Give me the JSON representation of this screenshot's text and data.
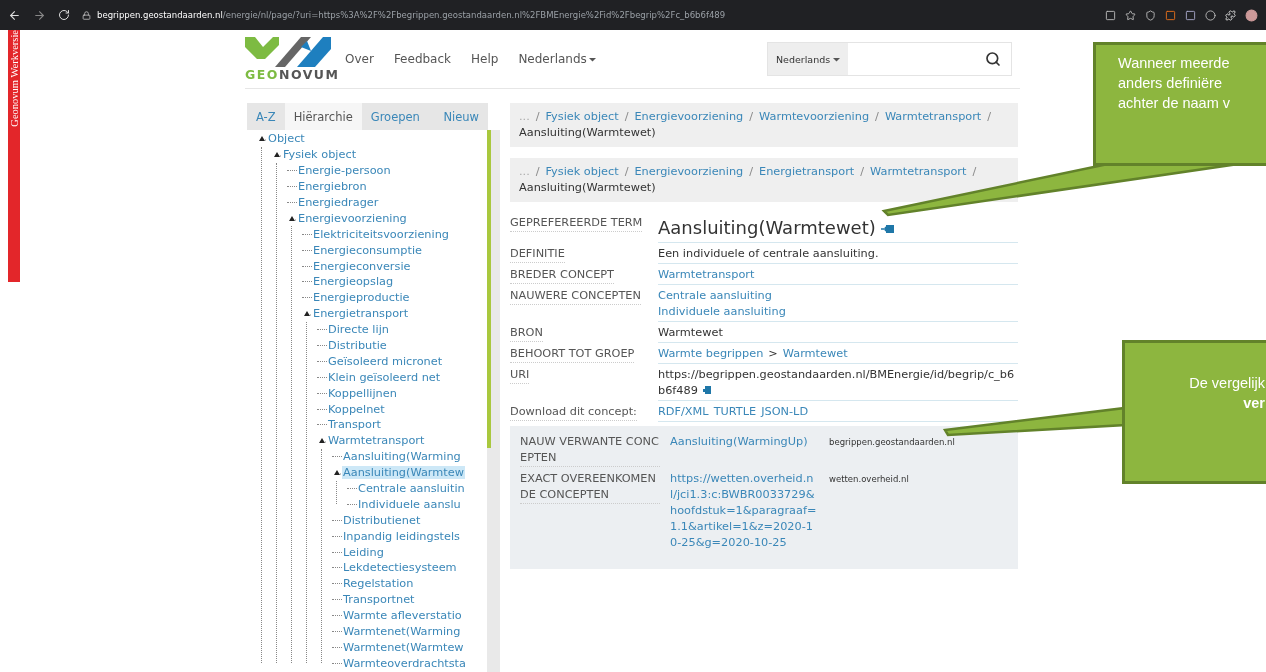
{
  "browser": {
    "host": "begrippen.geostandaarden.nl",
    "path": "/energie/nl/page/?uri=https%3A%2F%2Fbegrippen.geostandaarden.nl%2FBMEnergie%2Fid%2Fbegrip%2Fc_b6b6f489"
  },
  "side_banner": "Geonovum Werkversie",
  "logo_text": [
    "GEO",
    "NOVUM"
  ],
  "nav": [
    {
      "label": "Over",
      "kind": "link"
    },
    {
      "label": "Feedback",
      "kind": "link"
    },
    {
      "label": "Help",
      "kind": "link"
    },
    {
      "label": "Nederlands",
      "kind": "dropdown"
    }
  ],
  "search": {
    "language": "Nederlands"
  },
  "tabs": [
    {
      "label": "A-Z",
      "selected": false
    },
    {
      "label": "Hiërarchie",
      "selected": true
    },
    {
      "label": "Groepen",
      "selected": false
    },
    {
      "label": "Nieuw",
      "selected": false
    }
  ],
  "tree": [
    {
      "label": "Object",
      "expanded": true,
      "selected": false,
      "children": [
        {
          "label": "Fysiek object",
          "expanded": true,
          "selected": false,
          "children": [
            {
              "label": "Energie-persoon",
              "expanded": false,
              "selected": false
            },
            {
              "label": "Energiebron",
              "expanded": false,
              "selected": false
            },
            {
              "label": "Energiedrager",
              "expanded": false,
              "selected": false
            },
            {
              "label": "Energievoorziening",
              "expanded": true,
              "selected": false,
              "children": [
                {
                  "label": "Elektriciteitsvoorziening",
                  "expanded": false,
                  "selected": false
                },
                {
                  "label": "Energieconsumptie",
                  "expanded": false,
                  "selected": false
                },
                {
                  "label": "Energieconversie",
                  "expanded": false,
                  "selected": false
                },
                {
                  "label": "Energieopslag",
                  "expanded": false,
                  "selected": false
                },
                {
                  "label": "Energieproductie",
                  "expanded": false,
                  "selected": false
                },
                {
                  "label": "Energietransport",
                  "expanded": true,
                  "selected": false,
                  "children": [
                    {
                      "label": "Directe lijn",
                      "expanded": false,
                      "selected": false
                    },
                    {
                      "label": "Distributie",
                      "expanded": false,
                      "selected": false
                    },
                    {
                      "label": "Geïsoleerd micronet",
                      "expanded": false,
                      "selected": false
                    },
                    {
                      "label": "Klein geïsoleerd net",
                      "expanded": false,
                      "selected": false
                    },
                    {
                      "label": "Koppellijnen",
                      "expanded": false,
                      "selected": false
                    },
                    {
                      "label": "Koppelnet",
                      "expanded": false,
                      "selected": false
                    },
                    {
                      "label": "Transport",
                      "expanded": false,
                      "selected": false
                    },
                    {
                      "label": "Warmtetransport",
                      "expanded": true,
                      "selected": false,
                      "children": [
                        {
                          "label": "Aansluiting(Warming",
                          "expanded": false,
                          "selected": false
                        },
                        {
                          "label": "Aansluiting(Warmtew",
                          "expanded": true,
                          "selected": true,
                          "children": [
                            {
                              "label": "Centrale aansluitin",
                              "expanded": false,
                              "selected": false
                            },
                            {
                              "label": "Individuele aanslu",
                              "expanded": false,
                              "selected": false
                            }
                          ]
                        },
                        {
                          "label": "Distributienet",
                          "expanded": false,
                          "selected": false
                        },
                        {
                          "label": "Inpandig leidingstels",
                          "expanded": false,
                          "selected": false
                        },
                        {
                          "label": "Leiding",
                          "expanded": false,
                          "selected": false
                        },
                        {
                          "label": "Lekdetectiesysteem",
                          "expanded": false,
                          "selected": false
                        },
                        {
                          "label": "Regelstation",
                          "expanded": false,
                          "selected": false
                        },
                        {
                          "label": "Transportnet",
                          "expanded": false,
                          "selected": false
                        },
                        {
                          "label": "Warmte afleverstatio",
                          "expanded": false,
                          "selected": false
                        },
                        {
                          "label": "Warmtenet(Warming",
                          "expanded": false,
                          "selected": false
                        },
                        {
                          "label": "Warmtenet(Warmtew",
                          "expanded": false,
                          "selected": false
                        },
                        {
                          "label": "Warmteoverdrachtsta",
                          "expanded": false,
                          "selected": false
                        }
                      ]
                    }
                  ]
                }
              ]
            }
          ]
        }
      ]
    }
  ],
  "breadcrumbs": [
    {
      "separator": "/",
      "items": [
        {
          "label": "...",
          "kind": "ellipsis"
        },
        {
          "label": "Fysiek object",
          "kind": "link"
        },
        {
          "label": "Energievoorziening",
          "kind": "link"
        },
        {
          "label": "Warmtevoorziening",
          "kind": "link"
        },
        {
          "label": "Warmtetransport",
          "kind": "link"
        },
        {
          "label": "Aansluiting(Warmtewet)",
          "kind": "current"
        }
      ]
    },
    {
      "separator": "/",
      "items": [
        {
          "label": "...",
          "kind": "ellipsis"
        },
        {
          "label": "Fysiek object",
          "kind": "link"
        },
        {
          "label": "Energievoorziening",
          "kind": "link"
        },
        {
          "label": "Energietransport",
          "kind": "link"
        },
        {
          "label": "Warmtetransport",
          "kind": "link"
        },
        {
          "label": "Aansluiting(Warmtewet)",
          "kind": "current"
        }
      ]
    }
  ],
  "details": [
    {
      "label": "GEPREFEREERDE TERM",
      "kind": "title",
      "values": [
        "Aansluiting(Warmtewet)"
      ]
    },
    {
      "label": "DEFINITIE",
      "kind": "text",
      "values": [
        "Een individuele of centrale aansluiting."
      ]
    },
    {
      "label": "BREDER CONCEPT",
      "kind": "links",
      "values": [
        "Warmtetransport"
      ]
    },
    {
      "label": "NAUWERE CONCEPTEN",
      "kind": "links",
      "values": [
        "Centrale aansluiting",
        "Individuele aansluiting"
      ]
    },
    {
      "label": "BRON",
      "kind": "text",
      "values": [
        "Warmtewet"
      ]
    },
    {
      "label": "BEHOORT TOT GROEP",
      "kind": "path",
      "separator": ">",
      "values": [
        "Warmte begrippen",
        "Warmtewet"
      ]
    },
    {
      "label": "URI",
      "kind": "uri",
      "values": [
        "https://begrippen.geostandaarden.nl/BMEnergie/id/begrip/c_b6b6f489"
      ]
    },
    {
      "label": "Download dit concept:",
      "kind": "inline",
      "values": [
        "RDF/XML",
        "TURTLE",
        "JSON-LD"
      ]
    }
  ],
  "related": [
    {
      "label": "NAUW VERWANTE CONCEPTEN",
      "link": "Aansluiting(WarmingUp)",
      "source": "begrippen.geostandaarden.nl"
    },
    {
      "label": "EXACT OVEREENKOMENDE CONCEPTEN",
      "link": "https://wetten.overheid.nl/jci1.3:c:BWBR0033729&hoofdstuk=1&paragraaf=1.1&artikel=1&z=2020-10-25&g=2020-10-25",
      "source": "wetten.overheid.nl"
    }
  ],
  "callouts": [
    {
      "lines": [
        {
          "text": "Wanneer meerde",
          "bold": false
        },
        {
          "text": "anders definiëre",
          "bold": false
        },
        {
          "text": "achter de naam v",
          "bold": false
        }
      ]
    },
    {
      "lines": [
        {
          "text": "De vergelijk",
          "bold": false
        },
        {
          "text": "ver",
          "bold": true
        }
      ]
    }
  ]
}
